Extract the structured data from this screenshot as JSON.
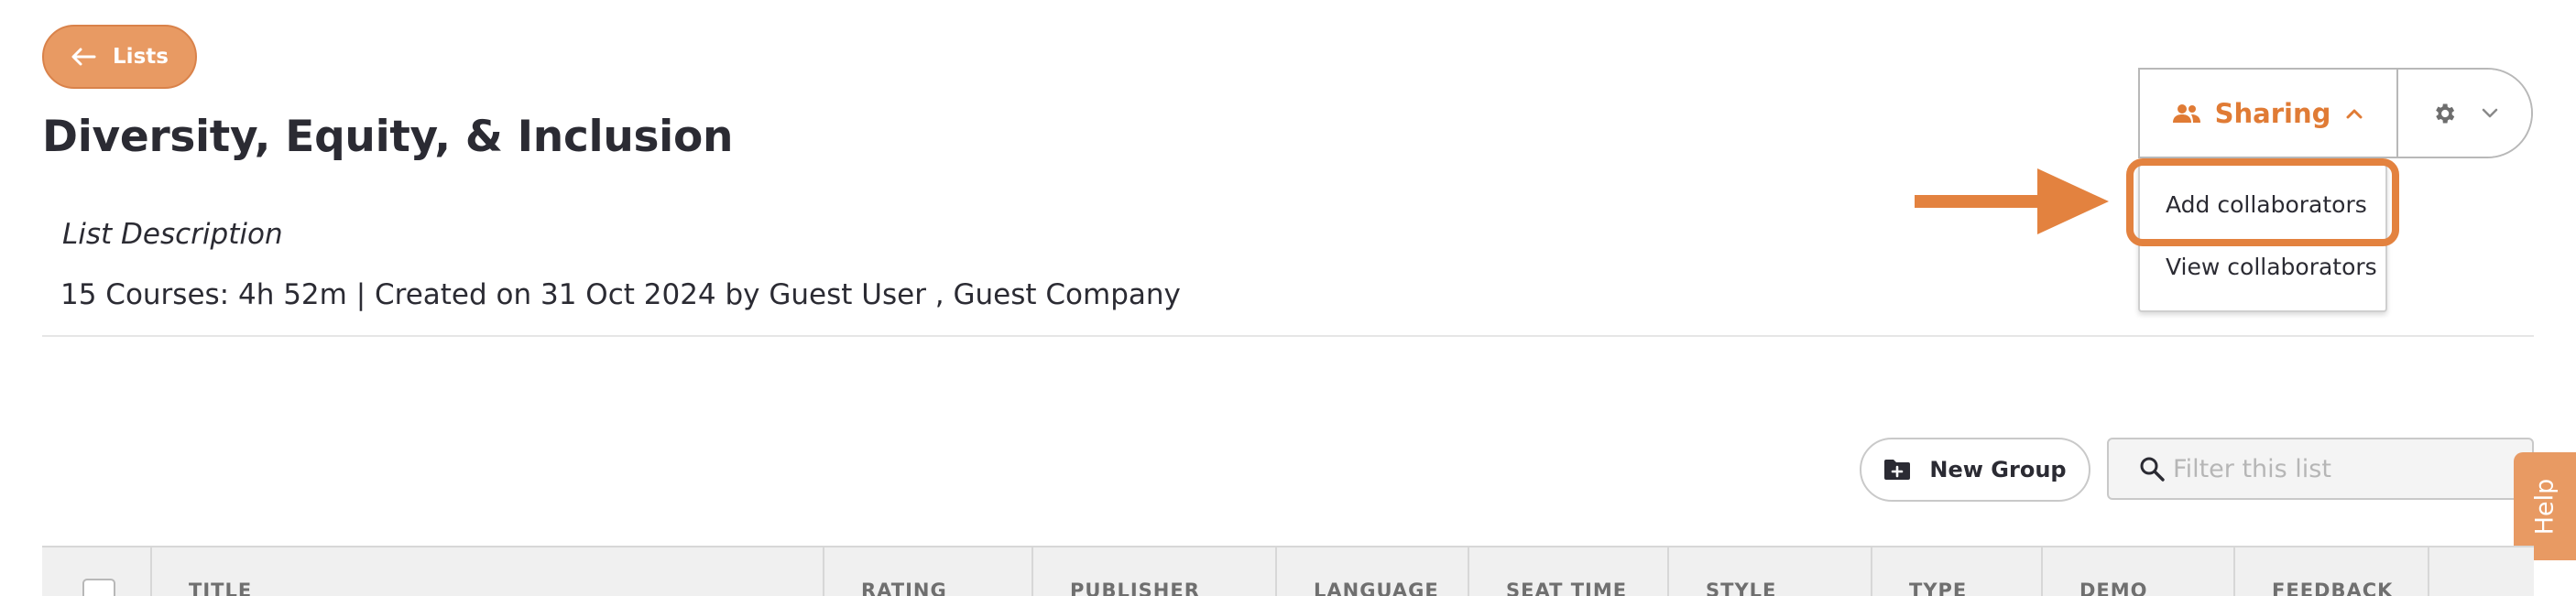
{
  "back_button": {
    "label": "Lists",
    "icon": "arrow-left-icon"
  },
  "page": {
    "title": "Diversity, Equity, & Inclusion",
    "description": "List Description",
    "meta": "15 Courses: 4h 52m | Created on 31 Oct 2024 by Guest User , Guest Company"
  },
  "sharing": {
    "label": "Sharing",
    "icon": "people-icon",
    "menu": [
      "Add collaborators",
      "View collaborators"
    ]
  },
  "toolbar": {
    "new_group_label": "New Group",
    "filter_placeholder": "Filter this list"
  },
  "help": {
    "label": "Help"
  },
  "table": {
    "columns": [
      "TITLE",
      "RATING",
      "PUBLISHER",
      "LANGUAGE",
      "SEAT TIME",
      "STYLE",
      "TYPE",
      "DEMO",
      "FEEDBACK"
    ]
  },
  "colors": {
    "accent": "#e07b35",
    "accent_light": "#e89a63",
    "text": "#2b2b33"
  }
}
